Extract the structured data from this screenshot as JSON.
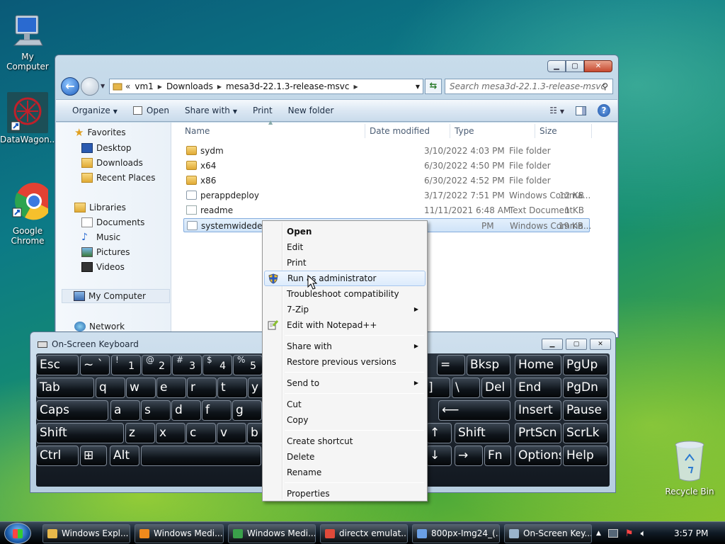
{
  "desktop": {
    "icons": [
      {
        "label": "My Computer"
      },
      {
        "label": "DataWagon..."
      },
      {
        "label": "Google Chrome"
      },
      {
        "label": "Recycle Bin"
      }
    ]
  },
  "explorer": {
    "breadcrumb": [
      "vm1",
      "Downloads",
      "mesa3d-22.1.3-release-msvc"
    ],
    "breadcrumb_prefix": "«",
    "search_placeholder": "Search mesa3d-22.1.3-release-msvc",
    "commands": [
      "Organize",
      "Open",
      "Share with",
      "Print",
      "New folder"
    ],
    "nav": {
      "favorites": "Favorites",
      "favorite_items": [
        "Desktop",
        "Downloads",
        "Recent Places"
      ],
      "libraries": "Libraries",
      "library_items": [
        "Documents",
        "Music",
        "Pictures",
        "Videos"
      ],
      "computer": "My Computer",
      "network": "Network"
    },
    "columns": [
      "Name",
      "Date modified",
      "Type",
      "Size"
    ],
    "files": [
      {
        "name": "sydm",
        "date": "3/10/2022 4:03 PM",
        "type": "File folder",
        "size": "",
        "kind": "folder"
      },
      {
        "name": "x64",
        "date": "6/30/2022 4:50 PM",
        "type": "File folder",
        "size": "",
        "kind": "folder"
      },
      {
        "name": "x86",
        "date": "6/30/2022 4:52 PM",
        "type": "File folder",
        "size": "",
        "kind": "folder"
      },
      {
        "name": "perappdeploy",
        "date": "3/17/2022 7:51 PM",
        "type": "Windows Comma...",
        "size": "12 KB",
        "kind": "cmd"
      },
      {
        "name": "readme",
        "date": "11/11/2021 6:48 AM",
        "type": "Text Document",
        "size": "1 KB",
        "kind": "txt"
      },
      {
        "name": "systemwidedeploy",
        "date": "PM",
        "type": "Windows Comma...",
        "size": "19 KB",
        "kind": "cmd"
      }
    ]
  },
  "context_menu": {
    "items": [
      {
        "label": "Open",
        "bold": true
      },
      {
        "label": "Edit"
      },
      {
        "label": "Print"
      },
      {
        "label": "Run as administrator",
        "highlight": true,
        "icon": "shield-icon"
      },
      {
        "label": "Troubleshoot compatibility"
      },
      {
        "label": "7-Zip",
        "submenu": true
      },
      {
        "label": "Edit with Notepad++",
        "icon": "notepad-icon"
      },
      {
        "separator": true
      },
      {
        "label": "Share with",
        "submenu": true
      },
      {
        "label": "Restore previous versions"
      },
      {
        "separator": true
      },
      {
        "label": "Send to",
        "submenu": true
      },
      {
        "separator": true
      },
      {
        "label": "Cut"
      },
      {
        "label": "Copy"
      },
      {
        "separator": true
      },
      {
        "label": "Create shortcut"
      },
      {
        "label": "Delete"
      },
      {
        "label": "Rename"
      },
      {
        "separator": true
      },
      {
        "label": "Properties"
      }
    ]
  },
  "osk": {
    "title": "On-Screen Keyboard",
    "rows": [
      [
        {
          "l": "Esc"
        },
        {
          "l": "~ `"
        },
        {
          "l": "1",
          "s": "!"
        },
        {
          "l": "2",
          "s": "@"
        },
        {
          "l": "3",
          "s": "#"
        },
        {
          "l": "4",
          "s": "$"
        },
        {
          "l": "5",
          "s": "%"
        },
        {
          "l": "="
        },
        {
          "l": "Bksp"
        },
        {
          "l": "Home"
        },
        {
          "l": "PgUp"
        }
      ],
      [
        {
          "l": "Tab"
        },
        {
          "l": "q"
        },
        {
          "l": "w"
        },
        {
          "l": "e"
        },
        {
          "l": "r"
        },
        {
          "l": "t"
        },
        {
          "l": "y"
        },
        {
          "l": "]"
        },
        {
          "l": "\\"
        },
        {
          "l": "Del"
        },
        {
          "l": "End"
        },
        {
          "l": "PgDn"
        }
      ],
      [
        {
          "l": "Caps"
        },
        {
          "l": "a"
        },
        {
          "l": "s"
        },
        {
          "l": "d"
        },
        {
          "l": "f"
        },
        {
          "l": "g"
        },
        {
          "l": "⟵"
        },
        {
          "l": "Insert"
        },
        {
          "l": "Pause"
        }
      ],
      [
        {
          "l": "Shift"
        },
        {
          "l": "z"
        },
        {
          "l": "x"
        },
        {
          "l": "c"
        },
        {
          "l": "v"
        },
        {
          "l": "b"
        },
        {
          "l": "↑"
        },
        {
          "l": "Shift"
        },
        {
          "l": "PrtScn"
        },
        {
          "l": "ScrLk"
        }
      ],
      [
        {
          "l": "Ctrl"
        },
        {
          "l": "⊞"
        },
        {
          "l": "Alt"
        },
        {
          "l": ""
        },
        {
          "l": "↓"
        },
        {
          "l": "→"
        },
        {
          "l": "Fn"
        },
        {
          "l": "Options"
        },
        {
          "l": "Help"
        }
      ]
    ]
  },
  "taskbar": {
    "items": [
      {
        "label": "Windows Expl...",
        "color": "#e8b84a"
      },
      {
        "label": "Windows Medi...",
        "color": "#f08a1c"
      },
      {
        "label": "Windows Medi...",
        "color": "#3aa04a"
      },
      {
        "label": "directx emulat...",
        "color": "#e04a3a"
      },
      {
        "label": "800px-Img24_(...",
        "color": "#6aa0e6"
      },
      {
        "label": "On-Screen Key...",
        "color": "#9ab4cc"
      }
    ],
    "clock": "3:57 PM"
  }
}
